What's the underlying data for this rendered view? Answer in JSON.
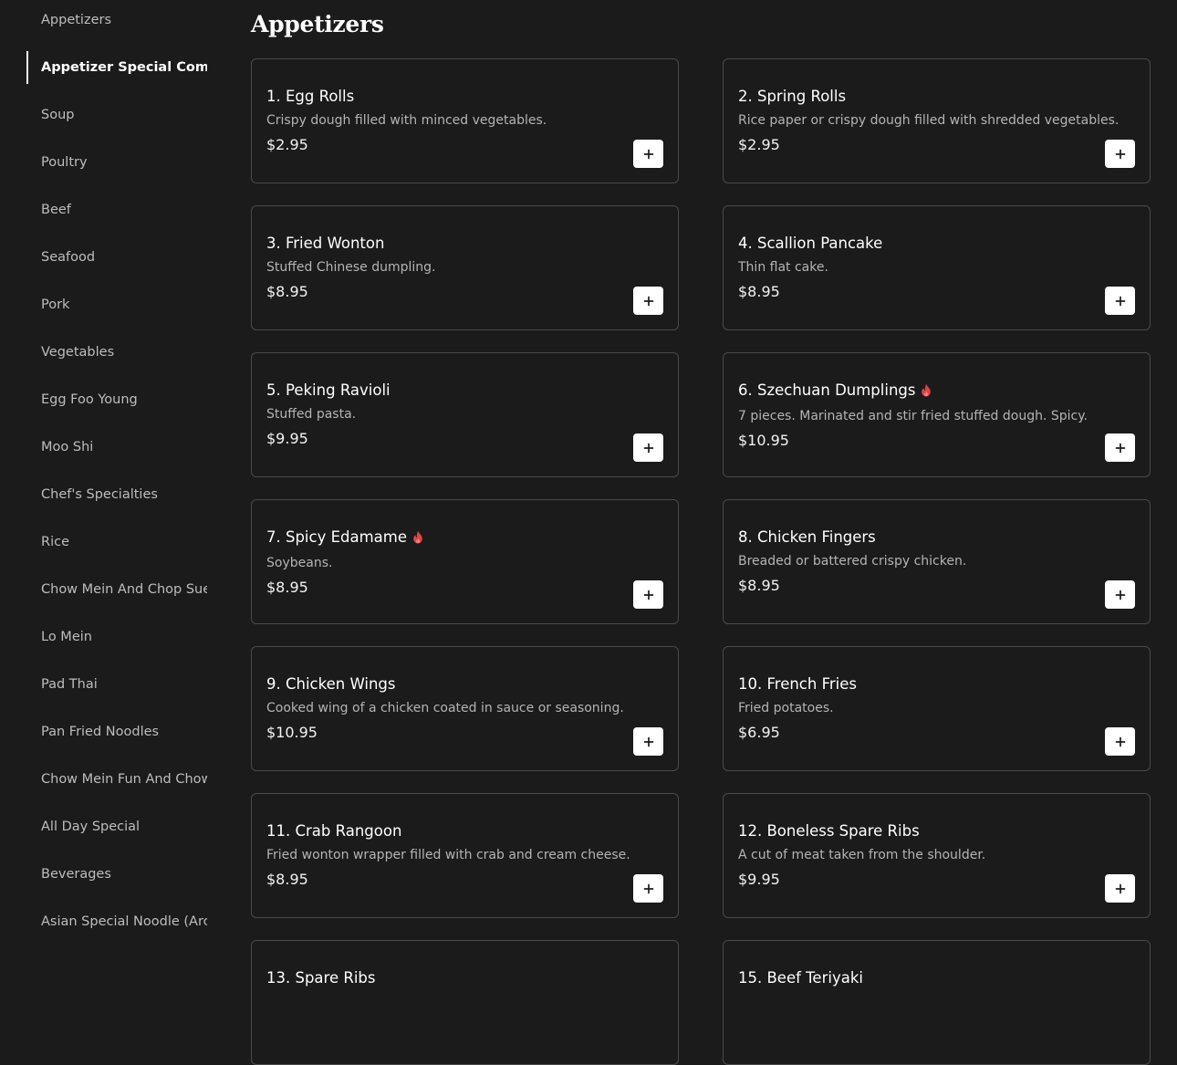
{
  "sidebar": {
    "active_index": 1,
    "items": [
      {
        "label": "Appetizers"
      },
      {
        "label": "Appetizer Special Combos"
      },
      {
        "label": "Soup"
      },
      {
        "label": "Poultry"
      },
      {
        "label": "Beef"
      },
      {
        "label": "Seafood"
      },
      {
        "label": "Pork"
      },
      {
        "label": "Vegetables"
      },
      {
        "label": "Egg Foo Young"
      },
      {
        "label": "Moo Shi"
      },
      {
        "label": "Chef's Specialties"
      },
      {
        "label": "Rice"
      },
      {
        "label": "Chow Mein And Chop Suey"
      },
      {
        "label": "Lo Mein"
      },
      {
        "label": "Pad Thai"
      },
      {
        "label": "Pan Fried Noodles"
      },
      {
        "label": "Chow Mein Fun And Chow Fun"
      },
      {
        "label": "All Day Special"
      },
      {
        "label": "Beverages"
      },
      {
        "label": "Asian Special Noodle (Archive)"
      }
    ]
  },
  "main": {
    "section_title": "Appetizers",
    "add_button_icon": "plus-icon",
    "spicy_icon": "flame-icon",
    "spicy_color": "#e04545",
    "items": [
      {
        "name": "1. Egg Rolls",
        "description": "Crispy dough filled with minced vegetables.",
        "price": "$2.95",
        "spicy": false
      },
      {
        "name": "2. Spring Rolls",
        "description": "Rice paper or crispy dough filled with shredded vegetables.",
        "price": "$2.95",
        "spicy": false
      },
      {
        "name": "3. Fried Wonton",
        "description": "Stuffed Chinese dumpling.",
        "price": "$8.95",
        "spicy": false
      },
      {
        "name": "4. Scallion Pancake",
        "description": "Thin flat cake.",
        "price": "$8.95",
        "spicy": false
      },
      {
        "name": "5. Peking Ravioli",
        "description": "Stuffed pasta.",
        "price": "$9.95",
        "spicy": false
      },
      {
        "name": "6. Szechuan Dumplings",
        "description": "7 pieces. Marinated and stir fried stuffed dough. Spicy.",
        "price": "$10.95",
        "spicy": true
      },
      {
        "name": "7. Spicy Edamame",
        "description": "Soybeans.",
        "price": "$8.95",
        "spicy": true
      },
      {
        "name": "8. Chicken Fingers",
        "description": "Breaded or battered crispy chicken.",
        "price": "$8.95",
        "spicy": false
      },
      {
        "name": "9. Chicken Wings",
        "description": "Cooked wing of a chicken coated in sauce or seasoning.",
        "price": "$10.95",
        "spicy": false
      },
      {
        "name": "10. French Fries",
        "description": "Fried potatoes.",
        "price": "$6.95",
        "spicy": false
      },
      {
        "name": "11. Crab Rangoon",
        "description": "Fried wonton wrapper filled with crab and cream cheese.",
        "price": "$8.95",
        "spicy": false
      },
      {
        "name": "12. Boneless Spare Ribs",
        "description": "A cut of meat taken from the shoulder.",
        "price": "$9.95",
        "spicy": false
      },
      {
        "name": "13. Spare Ribs",
        "description": "",
        "price": "",
        "spicy": false
      },
      {
        "name": "15. Beef Teriyaki",
        "description": "",
        "price": "",
        "spicy": false
      }
    ]
  }
}
